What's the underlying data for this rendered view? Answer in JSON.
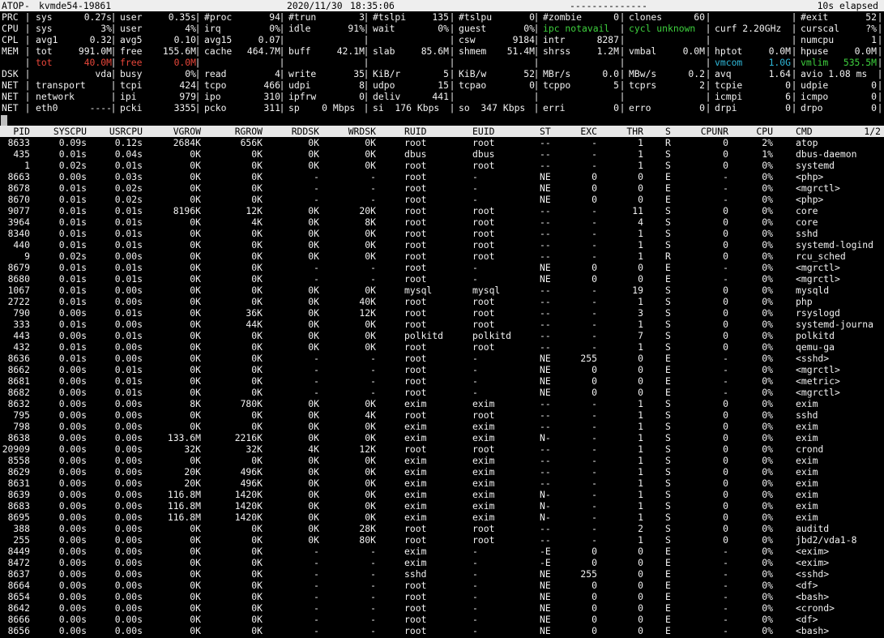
{
  "title_bar": {
    "app": "ATOP",
    "host": "kvmde54-19861",
    "date": "2020/11/30",
    "time": "18:35:06",
    "divider": "--------------",
    "elapsed": "10s elapsed"
  },
  "colors": {
    "red": "#e8463a",
    "green": "#3ed13e",
    "cyan": "#2fb7d8"
  },
  "sys_rows": [
    {
      "label": "PRC",
      "cells": [
        {
          "n": "sys",
          "v": "0.27s"
        },
        {
          "n": "user",
          "v": "0.35s"
        },
        {
          "n": "#proc",
          "v": "94"
        },
        {
          "n": "#trun",
          "v": "3"
        },
        {
          "n": "#tslpi",
          "v": "135"
        },
        {
          "n": "#tslpu",
          "v": "0"
        },
        {
          "n": "#zombie",
          "v": "0"
        },
        {
          "n": "clones",
          "v": "60"
        },
        {
          "n": "",
          "v": ""
        },
        {
          "n": "#exit",
          "v": "52"
        }
      ]
    },
    {
      "label": "CPU",
      "cells": [
        {
          "n": "sys",
          "v": "3%"
        },
        {
          "n": "user",
          "v": "4%"
        },
        {
          "n": "irq",
          "v": "0%"
        },
        {
          "n": "idle",
          "v": "91%"
        },
        {
          "n": "wait",
          "v": "0%"
        },
        {
          "n": "guest",
          "v": "0%"
        },
        {
          "n": "ipc notavail",
          "v": "",
          "color": "green"
        },
        {
          "n": "cycl unknown",
          "v": "",
          "color": "green"
        },
        {
          "n": "curf 2.20GHz",
          "v": ""
        },
        {
          "n": "curscal",
          "v": "?%"
        }
      ]
    },
    {
      "label": "CPL",
      "cells": [
        {
          "n": "avg1",
          "v": "0.32"
        },
        {
          "n": "avg5",
          "v": "0.10"
        },
        {
          "n": "avg15",
          "v": "0.07"
        },
        {
          "n": "",
          "v": ""
        },
        {
          "n": "",
          "v": ""
        },
        {
          "n": "csw",
          "v": "9184"
        },
        {
          "n": "intr",
          "v": "8287"
        },
        {
          "n": "",
          "v": ""
        },
        {
          "n": "",
          "v": ""
        },
        {
          "n": "numcpu",
          "v": "1"
        }
      ]
    },
    {
      "label": "MEM",
      "cells": [
        {
          "n": "tot",
          "v": "991.0M"
        },
        {
          "n": "free",
          "v": "155.6M"
        },
        {
          "n": "cache",
          "v": "464.7M"
        },
        {
          "n": "buff",
          "v": "42.1M"
        },
        {
          "n": "slab",
          "v": "85.6M"
        },
        {
          "n": "shmem",
          "v": "51.4M"
        },
        {
          "n": "shrss",
          "v": "1.2M"
        },
        {
          "n": "vmbal",
          "v": "0.0M"
        },
        {
          "n": "hptot",
          "v": "0.0M"
        },
        {
          "n": "hpuse",
          "v": "0.0M"
        }
      ]
    },
    {
      "label": "",
      "cells": [
        {
          "n": "tot",
          "v": "40.0M",
          "color": "red"
        },
        {
          "n": "free",
          "v": "0.0M",
          "color": "red"
        },
        {
          "n": "",
          "v": ""
        },
        {
          "n": "",
          "v": ""
        },
        {
          "n": "",
          "v": ""
        },
        {
          "n": "",
          "v": ""
        },
        {
          "n": "",
          "v": ""
        },
        {
          "n": "",
          "v": ""
        },
        {
          "n": "vmcom",
          "v": "1.0G",
          "color": "cyan"
        },
        {
          "n": "vmlim",
          "v": "535.5M",
          "color": "green"
        }
      ]
    },
    {
      "label": "DSK",
      "cells": [
        {
          "n": "",
          "v": "vda"
        },
        {
          "n": "busy",
          "v": "0%"
        },
        {
          "n": "read",
          "v": "4"
        },
        {
          "n": "write",
          "v": "35"
        },
        {
          "n": "KiB/r",
          "v": "5"
        },
        {
          "n": "KiB/w",
          "v": "52"
        },
        {
          "n": "MBr/s",
          "v": "0.0"
        },
        {
          "n": "MBw/s",
          "v": "0.2"
        },
        {
          "n": "avq",
          "v": "1.64"
        },
        {
          "n": "avio 1.08 ms",
          "v": ""
        }
      ]
    },
    {
      "label": "NET",
      "cells": [
        {
          "n": "transport",
          "v": ""
        },
        {
          "n": "tcpi",
          "v": "424"
        },
        {
          "n": "tcpo",
          "v": "466"
        },
        {
          "n": "udpi",
          "v": "8"
        },
        {
          "n": "udpo",
          "v": "15"
        },
        {
          "n": "tcpao",
          "v": "0"
        },
        {
          "n": "tcppo",
          "v": "5"
        },
        {
          "n": "tcprs",
          "v": "2"
        },
        {
          "n": "tcpie",
          "v": "0"
        },
        {
          "n": "udpie",
          "v": "0"
        }
      ]
    },
    {
      "label": "NET",
      "cells": [
        {
          "n": "network",
          "v": ""
        },
        {
          "n": "ipi",
          "v": "979"
        },
        {
          "n": "ipo",
          "v": "310"
        },
        {
          "n": "ipfrw",
          "v": "0"
        },
        {
          "n": "deliv",
          "v": "441"
        },
        {
          "n": "",
          "v": ""
        },
        {
          "n": "",
          "v": ""
        },
        {
          "n": "",
          "v": ""
        },
        {
          "n": "icmpi",
          "v": "6"
        },
        {
          "n": "icmpo",
          "v": "0"
        }
      ]
    },
    {
      "label": "NET",
      "cells": [
        {
          "n": "eth0",
          "v": "----"
        },
        {
          "n": "pcki",
          "v": "3355"
        },
        {
          "n": "pcko",
          "v": "311"
        },
        {
          "n": "sp    0 Mbps",
          "v": ""
        },
        {
          "n": "si  176 Kbps",
          "v": ""
        },
        {
          "n": "so  347 Kbps",
          "v": ""
        },
        {
          "n": "erri",
          "v": "0"
        },
        {
          "n": "erro",
          "v": "0"
        },
        {
          "n": "drpi",
          "v": "0"
        },
        {
          "n": "drpo",
          "v": "0"
        }
      ]
    }
  ],
  "proc_table": {
    "page": "1/2",
    "columns": [
      "PID",
      "SYSCPU",
      "USRCPU",
      "VGROW",
      "RGROW",
      "RDDSK",
      "WRDSK",
      "RUID",
      "EUID",
      "ST",
      "EXC",
      "THR",
      "S",
      "CPUNR",
      "CPU",
      "CMD"
    ],
    "rows": [
      [
        "8633",
        "0.09s",
        "0.12s",
        "2684K",
        "656K",
        "0K",
        "0K",
        "root",
        "root",
        "--",
        "-",
        "1",
        "R",
        "0",
        "2%",
        "atop"
      ],
      [
        "435",
        "0.01s",
        "0.04s",
        "0K",
        "0K",
        "0K",
        "0K",
        "dbus",
        "dbus",
        "--",
        "-",
        "1",
        "S",
        "0",
        "1%",
        "dbus-daemon"
      ],
      [
        "1",
        "0.02s",
        "0.01s",
        "0K",
        "0K",
        "0K",
        "0K",
        "root",
        "root",
        "--",
        "-",
        "1",
        "S",
        "0",
        "0%",
        "systemd"
      ],
      [
        "8663",
        "0.00s",
        "0.03s",
        "0K",
        "0K",
        "-",
        "-",
        "root",
        "-",
        "NE",
        "0",
        "0",
        "E",
        "-",
        "0%",
        "<php>"
      ],
      [
        "8678",
        "0.01s",
        "0.02s",
        "0K",
        "0K",
        "-",
        "-",
        "root",
        "-",
        "NE",
        "0",
        "0",
        "E",
        "-",
        "0%",
        "<mgrctl>"
      ],
      [
        "8670",
        "0.01s",
        "0.02s",
        "0K",
        "0K",
        "-",
        "-",
        "root",
        "-",
        "NE",
        "0",
        "0",
        "E",
        "-",
        "0%",
        "<php>"
      ],
      [
        "9077",
        "0.01s",
        "0.01s",
        "8196K",
        "12K",
        "0K",
        "20K",
        "root",
        "root",
        "--",
        "-",
        "11",
        "S",
        "0",
        "0%",
        "core"
      ],
      [
        "3964",
        "0.01s",
        "0.01s",
        "0K",
        "4K",
        "0K",
        "8K",
        "root",
        "root",
        "--",
        "-",
        "4",
        "S",
        "0",
        "0%",
        "core"
      ],
      [
        "8340",
        "0.01s",
        "0.01s",
        "0K",
        "0K",
        "0K",
        "0K",
        "root",
        "root",
        "--",
        "-",
        "1",
        "S",
        "0",
        "0%",
        "sshd"
      ],
      [
        "440",
        "0.01s",
        "0.01s",
        "0K",
        "0K",
        "0K",
        "0K",
        "root",
        "root",
        "--",
        "-",
        "1",
        "S",
        "0",
        "0%",
        "systemd-logind"
      ],
      [
        "9",
        "0.02s",
        "0.00s",
        "0K",
        "0K",
        "0K",
        "0K",
        "root",
        "root",
        "--",
        "-",
        "1",
        "R",
        "0",
        "0%",
        "rcu_sched"
      ],
      [
        "8679",
        "0.01s",
        "0.01s",
        "0K",
        "0K",
        "-",
        "-",
        "root",
        "-",
        "NE",
        "0",
        "0",
        "E",
        "-",
        "0%",
        "<mgrctl>"
      ],
      [
        "8680",
        "0.01s",
        "0.01s",
        "0K",
        "0K",
        "-",
        "-",
        "root",
        "-",
        "NE",
        "0",
        "0",
        "E",
        "-",
        "0%",
        "<mgrctl>"
      ],
      [
        "1067",
        "0.01s",
        "0.00s",
        "0K",
        "0K",
        "0K",
        "0K",
        "mysql",
        "mysql",
        "--",
        "-",
        "19",
        "S",
        "0",
        "0%",
        "mysqld"
      ],
      [
        "2722",
        "0.01s",
        "0.00s",
        "0K",
        "0K",
        "0K",
        "40K",
        "root",
        "root",
        "--",
        "-",
        "1",
        "S",
        "0",
        "0%",
        "php"
      ],
      [
        "790",
        "0.00s",
        "0.01s",
        "0K",
        "36K",
        "0K",
        "12K",
        "root",
        "root",
        "--",
        "-",
        "3",
        "S",
        "0",
        "0%",
        "rsyslogd"
      ],
      [
        "333",
        "0.01s",
        "0.00s",
        "0K",
        "44K",
        "0K",
        "0K",
        "root",
        "root",
        "--",
        "-",
        "1",
        "S",
        "0",
        "0%",
        "systemd-journa"
      ],
      [
        "443",
        "0.00s",
        "0.01s",
        "0K",
        "0K",
        "0K",
        "0K",
        "polkitd",
        "polkitd",
        "--",
        "-",
        "7",
        "S",
        "0",
        "0%",
        "polkitd"
      ],
      [
        "432",
        "0.01s",
        "0.00s",
        "0K",
        "0K",
        "0K",
        "0K",
        "root",
        "root",
        "--",
        "-",
        "1",
        "S",
        "0",
        "0%",
        "qemu-ga"
      ],
      [
        "8636",
        "0.01s",
        "0.00s",
        "0K",
        "0K",
        "-",
        "-",
        "root",
        "-",
        "NE",
        "255",
        "0",
        "E",
        "-",
        "0%",
        "<sshd>"
      ],
      [
        "8662",
        "0.00s",
        "0.01s",
        "0K",
        "0K",
        "-",
        "-",
        "root",
        "-",
        "NE",
        "0",
        "0",
        "E",
        "-",
        "0%",
        "<mgrctl>"
      ],
      [
        "8681",
        "0.00s",
        "0.01s",
        "0K",
        "0K",
        "-",
        "-",
        "root",
        "-",
        "NE",
        "0",
        "0",
        "E",
        "-",
        "0%",
        "<metric>"
      ],
      [
        "8682",
        "0.00s",
        "0.01s",
        "0K",
        "0K",
        "-",
        "-",
        "root",
        "-",
        "NE",
        "0",
        "0",
        "E",
        "-",
        "0%",
        "<mgrctl>"
      ],
      [
        "8632",
        "0.00s",
        "0.00s",
        "8K",
        "780K",
        "0K",
        "0K",
        "exim",
        "exim",
        "--",
        "-",
        "1",
        "S",
        "0",
        "0%",
        "exim"
      ],
      [
        "795",
        "0.00s",
        "0.00s",
        "0K",
        "0K",
        "0K",
        "4K",
        "root",
        "root",
        "--",
        "-",
        "1",
        "S",
        "0",
        "0%",
        "sshd"
      ],
      [
        "798",
        "0.00s",
        "0.00s",
        "0K",
        "0K",
        "0K",
        "0K",
        "exim",
        "exim",
        "--",
        "-",
        "1",
        "S",
        "0",
        "0%",
        "exim"
      ],
      [
        "8638",
        "0.00s",
        "0.00s",
        "133.6M",
        "2216K",
        "0K",
        "0K",
        "exim",
        "exim",
        "N-",
        "-",
        "1",
        "S",
        "0",
        "0%",
        "exim"
      ],
      [
        "20909",
        "0.00s",
        "0.00s",
        "32K",
        "32K",
        "4K",
        "12K",
        "root",
        "root",
        "--",
        "-",
        "1",
        "S",
        "0",
        "0%",
        "crond"
      ],
      [
        "8558",
        "0.00s",
        "0.00s",
        "0K",
        "0K",
        "0K",
        "0K",
        "exim",
        "exim",
        "--",
        "-",
        "1",
        "S",
        "0",
        "0%",
        "exim"
      ],
      [
        "8629",
        "0.00s",
        "0.00s",
        "20K",
        "496K",
        "0K",
        "0K",
        "exim",
        "exim",
        "--",
        "-",
        "1",
        "S",
        "0",
        "0%",
        "exim"
      ],
      [
        "8631",
        "0.00s",
        "0.00s",
        "20K",
        "496K",
        "0K",
        "0K",
        "exim",
        "exim",
        "--",
        "-",
        "1",
        "S",
        "0",
        "0%",
        "exim"
      ],
      [
        "8639",
        "0.00s",
        "0.00s",
        "116.8M",
        "1420K",
        "0K",
        "0K",
        "exim",
        "exim",
        "N-",
        "-",
        "1",
        "S",
        "0",
        "0%",
        "exim"
      ],
      [
        "8683",
        "0.00s",
        "0.00s",
        "116.8M",
        "1420K",
        "0K",
        "0K",
        "exim",
        "exim",
        "N-",
        "-",
        "1",
        "S",
        "0",
        "0%",
        "exim"
      ],
      [
        "8695",
        "0.00s",
        "0.00s",
        "116.8M",
        "1420K",
        "0K",
        "0K",
        "exim",
        "exim",
        "N-",
        "-",
        "1",
        "S",
        "0",
        "0%",
        "exim"
      ],
      [
        "388",
        "0.00s",
        "0.00s",
        "0K",
        "0K",
        "0K",
        "28K",
        "root",
        "root",
        "--",
        "-",
        "2",
        "S",
        "0",
        "0%",
        "auditd"
      ],
      [
        "255",
        "0.00s",
        "0.00s",
        "0K",
        "0K",
        "0K",
        "80K",
        "root",
        "root",
        "--",
        "-",
        "1",
        "S",
        "0",
        "0%",
        "jbd2/vda1-8"
      ],
      [
        "8449",
        "0.00s",
        "0.00s",
        "0K",
        "0K",
        "-",
        "-",
        "exim",
        "-",
        "-E",
        "0",
        "0",
        "E",
        "-",
        "0%",
        "<exim>"
      ],
      [
        "8472",
        "0.00s",
        "0.00s",
        "0K",
        "0K",
        "-",
        "-",
        "exim",
        "-",
        "-E",
        "0",
        "0",
        "E",
        "-",
        "0%",
        "<exim>"
      ],
      [
        "8637",
        "0.00s",
        "0.00s",
        "0K",
        "0K",
        "-",
        "-",
        "sshd",
        "-",
        "NE",
        "255",
        "0",
        "E",
        "-",
        "0%",
        "<sshd>"
      ],
      [
        "8664",
        "0.00s",
        "0.00s",
        "0K",
        "0K",
        "-",
        "-",
        "root",
        "-",
        "NE",
        "0",
        "0",
        "E",
        "-",
        "0%",
        "<df>"
      ],
      [
        "8654",
        "0.00s",
        "0.00s",
        "0K",
        "0K",
        "-",
        "-",
        "root",
        "-",
        "NE",
        "0",
        "0",
        "E",
        "-",
        "0%",
        "<bash>"
      ],
      [
        "8642",
        "0.00s",
        "0.00s",
        "0K",
        "0K",
        "-",
        "-",
        "root",
        "-",
        "NE",
        "0",
        "0",
        "E",
        "-",
        "0%",
        "<crond>"
      ],
      [
        "8666",
        "0.00s",
        "0.00s",
        "0K",
        "0K",
        "-",
        "-",
        "root",
        "-",
        "NE",
        "0",
        "0",
        "E",
        "-",
        "0%",
        "<df>"
      ],
      [
        "8656",
        "0.00s",
        "0.00s",
        "0K",
        "0K",
        "-",
        "-",
        "root",
        "-",
        "NE",
        "0",
        "0",
        "E",
        "-",
        "0%",
        "<bash>"
      ]
    ]
  }
}
